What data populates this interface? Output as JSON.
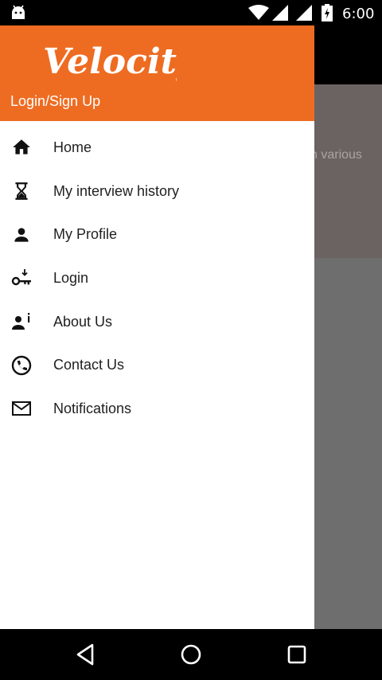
{
  "status_bar": {
    "time": "6:00",
    "icons": [
      "android-icon",
      "wifi-icon",
      "signal-icon",
      "signal-icon",
      "battery-icon"
    ]
  },
  "background": {
    "card_text": "n various"
  },
  "drawer": {
    "brand": "Velocity",
    "login_label": "Login/Sign Up",
    "header_color": "#ee6c22",
    "menu": [
      {
        "label": "Home",
        "icon": "home-icon"
      },
      {
        "label": "My interview history",
        "icon": "hourglass-icon"
      },
      {
        "label": "My Profile",
        "icon": "person-icon"
      },
      {
        "label": "Login",
        "icon": "key-icon"
      },
      {
        "label": "About Us",
        "icon": "person-info-icon"
      },
      {
        "label": "Contact Us",
        "icon": "phone-icon"
      },
      {
        "label": "Notifications",
        "icon": "mail-icon"
      }
    ]
  },
  "nav_bar": {
    "icons": [
      "back-icon",
      "home-circle-icon",
      "recents-icon"
    ]
  }
}
